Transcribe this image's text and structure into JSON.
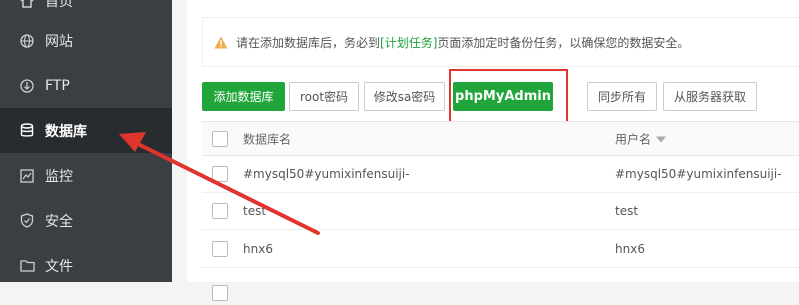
{
  "sidebar": {
    "items": [
      {
        "label": "首页",
        "icon": "home-icon",
        "active": false
      },
      {
        "label": "网站",
        "icon": "globe-icon",
        "active": false
      },
      {
        "label": "FTP",
        "icon": "ftp-icon",
        "active": false
      },
      {
        "label": "数据库",
        "icon": "database-icon",
        "active": true
      },
      {
        "label": "监控",
        "icon": "monitor-icon",
        "active": false
      },
      {
        "label": "安全",
        "icon": "shield-icon",
        "active": false
      },
      {
        "label": "文件",
        "icon": "folder-icon",
        "active": false
      }
    ]
  },
  "notice": {
    "prefix": "请在添加数据库后，务必到",
    "link": "[计划任务]",
    "suffix": "页面添加定时备份任务，以确保您的数据安全。"
  },
  "toolbar": {
    "add_db": "添加数据库",
    "root_pw": "root密码",
    "sa_pw": "修改sa密码",
    "phpmyadmin": "phpMyAdmin",
    "sync_all": "同步所有",
    "fetch_server": "从服务器获取"
  },
  "table": {
    "headers": {
      "name": "数据库名",
      "user": "用户名"
    },
    "rows": [
      {
        "name": "#mysql50#yumixinfensuiji-",
        "user": "#mysql50#yumixinfensuiji-"
      },
      {
        "name": "test",
        "user": "test"
      },
      {
        "name": "hnx6",
        "user": "hnx6"
      }
    ]
  },
  "colors": {
    "accent": "#20a53a",
    "sidebar_bg": "#3b3f43",
    "highlight": "#e0342e",
    "warning": "#f0ad4e"
  }
}
